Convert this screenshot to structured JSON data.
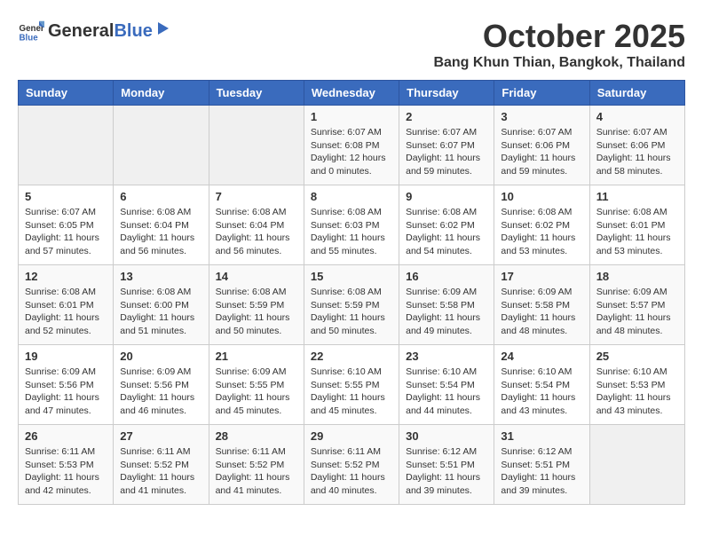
{
  "header": {
    "logo_general": "General",
    "logo_blue": "Blue",
    "month": "October 2025",
    "location": "Bang Khun Thian, Bangkok, Thailand"
  },
  "days_of_week": [
    "Sunday",
    "Monday",
    "Tuesday",
    "Wednesday",
    "Thursday",
    "Friday",
    "Saturday"
  ],
  "weeks": [
    [
      {
        "day": "",
        "content": ""
      },
      {
        "day": "",
        "content": ""
      },
      {
        "day": "",
        "content": ""
      },
      {
        "day": "1",
        "content": "Sunrise: 6:07 AM\nSunset: 6:08 PM\nDaylight: 12 hours\nand 0 minutes."
      },
      {
        "day": "2",
        "content": "Sunrise: 6:07 AM\nSunset: 6:07 PM\nDaylight: 11 hours\nand 59 minutes."
      },
      {
        "day": "3",
        "content": "Sunrise: 6:07 AM\nSunset: 6:06 PM\nDaylight: 11 hours\nand 59 minutes."
      },
      {
        "day": "4",
        "content": "Sunrise: 6:07 AM\nSunset: 6:06 PM\nDaylight: 11 hours\nand 58 minutes."
      }
    ],
    [
      {
        "day": "5",
        "content": "Sunrise: 6:07 AM\nSunset: 6:05 PM\nDaylight: 11 hours\nand 57 minutes."
      },
      {
        "day": "6",
        "content": "Sunrise: 6:08 AM\nSunset: 6:04 PM\nDaylight: 11 hours\nand 56 minutes."
      },
      {
        "day": "7",
        "content": "Sunrise: 6:08 AM\nSunset: 6:04 PM\nDaylight: 11 hours\nand 56 minutes."
      },
      {
        "day": "8",
        "content": "Sunrise: 6:08 AM\nSunset: 6:03 PM\nDaylight: 11 hours\nand 55 minutes."
      },
      {
        "day": "9",
        "content": "Sunrise: 6:08 AM\nSunset: 6:02 PM\nDaylight: 11 hours\nand 54 minutes."
      },
      {
        "day": "10",
        "content": "Sunrise: 6:08 AM\nSunset: 6:02 PM\nDaylight: 11 hours\nand 53 minutes."
      },
      {
        "day": "11",
        "content": "Sunrise: 6:08 AM\nSunset: 6:01 PM\nDaylight: 11 hours\nand 53 minutes."
      }
    ],
    [
      {
        "day": "12",
        "content": "Sunrise: 6:08 AM\nSunset: 6:01 PM\nDaylight: 11 hours\nand 52 minutes."
      },
      {
        "day": "13",
        "content": "Sunrise: 6:08 AM\nSunset: 6:00 PM\nDaylight: 11 hours\nand 51 minutes."
      },
      {
        "day": "14",
        "content": "Sunrise: 6:08 AM\nSunset: 5:59 PM\nDaylight: 11 hours\nand 50 minutes."
      },
      {
        "day": "15",
        "content": "Sunrise: 6:08 AM\nSunset: 5:59 PM\nDaylight: 11 hours\nand 50 minutes."
      },
      {
        "day": "16",
        "content": "Sunrise: 6:09 AM\nSunset: 5:58 PM\nDaylight: 11 hours\nand 49 minutes."
      },
      {
        "day": "17",
        "content": "Sunrise: 6:09 AM\nSunset: 5:58 PM\nDaylight: 11 hours\nand 48 minutes."
      },
      {
        "day": "18",
        "content": "Sunrise: 6:09 AM\nSunset: 5:57 PM\nDaylight: 11 hours\nand 48 minutes."
      }
    ],
    [
      {
        "day": "19",
        "content": "Sunrise: 6:09 AM\nSunset: 5:56 PM\nDaylight: 11 hours\nand 47 minutes."
      },
      {
        "day": "20",
        "content": "Sunrise: 6:09 AM\nSunset: 5:56 PM\nDaylight: 11 hours\nand 46 minutes."
      },
      {
        "day": "21",
        "content": "Sunrise: 6:09 AM\nSunset: 5:55 PM\nDaylight: 11 hours\nand 45 minutes."
      },
      {
        "day": "22",
        "content": "Sunrise: 6:10 AM\nSunset: 5:55 PM\nDaylight: 11 hours\nand 45 minutes."
      },
      {
        "day": "23",
        "content": "Sunrise: 6:10 AM\nSunset: 5:54 PM\nDaylight: 11 hours\nand 44 minutes."
      },
      {
        "day": "24",
        "content": "Sunrise: 6:10 AM\nSunset: 5:54 PM\nDaylight: 11 hours\nand 43 minutes."
      },
      {
        "day": "25",
        "content": "Sunrise: 6:10 AM\nSunset: 5:53 PM\nDaylight: 11 hours\nand 43 minutes."
      }
    ],
    [
      {
        "day": "26",
        "content": "Sunrise: 6:11 AM\nSunset: 5:53 PM\nDaylight: 11 hours\nand 42 minutes."
      },
      {
        "day": "27",
        "content": "Sunrise: 6:11 AM\nSunset: 5:52 PM\nDaylight: 11 hours\nand 41 minutes."
      },
      {
        "day": "28",
        "content": "Sunrise: 6:11 AM\nSunset: 5:52 PM\nDaylight: 11 hours\nand 41 minutes."
      },
      {
        "day": "29",
        "content": "Sunrise: 6:11 AM\nSunset: 5:52 PM\nDaylight: 11 hours\nand 40 minutes."
      },
      {
        "day": "30",
        "content": "Sunrise: 6:12 AM\nSunset: 5:51 PM\nDaylight: 11 hours\nand 39 minutes."
      },
      {
        "day": "31",
        "content": "Sunrise: 6:12 AM\nSunset: 5:51 PM\nDaylight: 11 hours\nand 39 minutes."
      },
      {
        "day": "",
        "content": ""
      }
    ]
  ]
}
